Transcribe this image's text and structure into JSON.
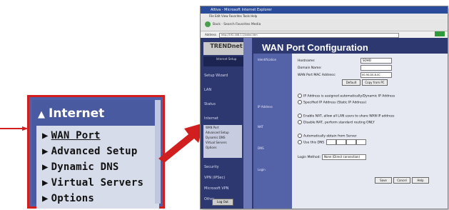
{
  "zoom_menu": {
    "header": "Internet",
    "items": [
      {
        "label": "WAN Port",
        "active": true
      },
      {
        "label": "Advanced Setup",
        "active": false
      },
      {
        "label": "Dynamic DNS",
        "active": false
      },
      {
        "label": "Virtual Servers",
        "active": false
      },
      {
        "label": "Options",
        "active": false
      }
    ]
  },
  "browser": {
    "window_title": "Altiva - Microsoft Internet Explorer",
    "menu_bar": "File  Edit  View  Favorites  Tools  Help",
    "toolbar": "Back  ·  Search  Favorites  Media",
    "address_label": "Address",
    "address": "http://192.168.1.1/index.htm",
    "logo": "TRENDnet",
    "sidebar_sub": "Internet Setup",
    "sidebar_items": [
      "Setup Wizard",
      "LAN",
      "Status",
      "Internet"
    ],
    "sidebar_subitems": [
      "WAN Port",
      "Advanced Setup",
      "Dynamic DNS",
      "Virtual Servers",
      "Options"
    ],
    "sidebar_lower": [
      "Security",
      "VPN (IPSec)",
      "Microsoft VPN",
      "Other"
    ],
    "logout": "Log Out",
    "heading": "WAN Port Configuration",
    "labels": [
      "Identification",
      "IP Address",
      "NAT",
      "DNS",
      "Login"
    ],
    "fields": {
      "hostname_label": "Hostname:",
      "hostname_value": "SOHO",
      "domain_label": "Domain Name:",
      "mac_label": "WAN Port MAC Address:",
      "mac_value": "00-90-D0-8-0C",
      "default_btn": "Default",
      "copy_btn": "Copy from PC",
      "ip_auto": "IP Address is assigned automatically/Dynamic IP Address",
      "ip_static": "Specified IP Address (Static IP Address)",
      "nat_enable": "Enable NAT, allow all LAN users to share WAN IP address",
      "nat_disable": "Disable NAT, perform standard routing ONLY",
      "dns_auto": "Automatically obtain from Server",
      "dns_use": "Use this DNS",
      "login_label": "Login Method:",
      "login_value": "None (Direct connection)",
      "save_btn": "Save",
      "cancel_btn": "Cancel",
      "help_btn": "Help"
    }
  }
}
